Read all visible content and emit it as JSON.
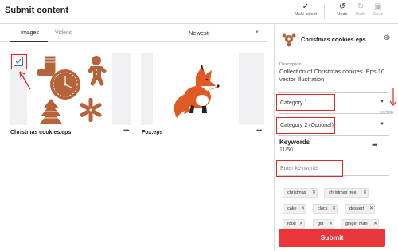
{
  "header": {
    "title": "Submit content",
    "tools": {
      "multiselect": "Multi-select",
      "undo": "Undo",
      "redo": "Redo",
      "save": "Save"
    }
  },
  "tabs": [
    {
      "label": "Images",
      "active": true
    },
    {
      "label": "Videos",
      "active": false
    }
  ],
  "sort": {
    "selected": "Newest"
  },
  "files": [
    {
      "name": "Christmas cookies.eps",
      "selected": true,
      "icon": "christmas-cookies-thumbnail"
    },
    {
      "name": "Fox.eps",
      "selected": false,
      "icon": "fox-thumbnail"
    }
  ],
  "detail": {
    "title": "Christmas cookies.eps",
    "description": {
      "label": "Description",
      "value": "Collection of Christmas cookies. Eps 10 vector illustration",
      "count": "59/200"
    },
    "category1": "Category 1",
    "category2": "Category 2 (Optional)",
    "keywords": {
      "label": "Keywords",
      "count": "11/50",
      "placeholder": "Enter keywords",
      "chips": [
        {
          "label": "christmas"
        },
        {
          "label": "christmas tree"
        },
        {
          "label": "cake"
        },
        {
          "label": "clock"
        },
        {
          "label": "dessert"
        },
        {
          "label": "food"
        },
        {
          "label": "gift"
        },
        {
          "label": "ginger man"
        }
      ]
    },
    "submit_label": "Submit"
  },
  "colors": {
    "accent": "#e8363a",
    "annotation": "#e02828",
    "checkbox": "#3b6fd6",
    "cookie": "#b7633a",
    "fox": "#e05a26"
  }
}
